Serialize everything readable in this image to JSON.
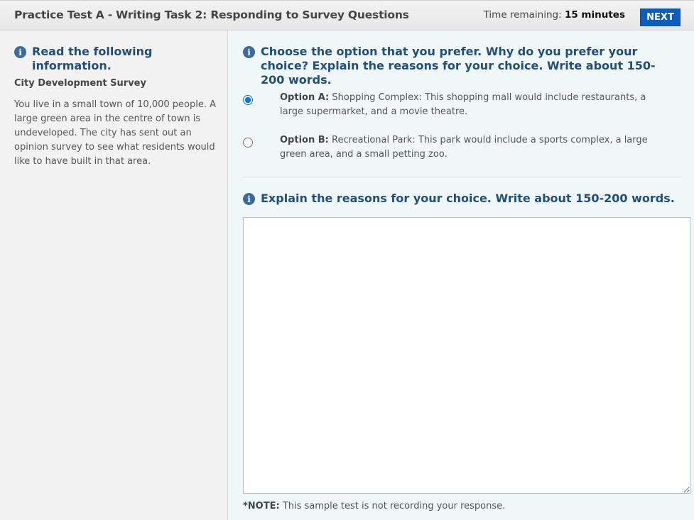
{
  "header": {
    "title": "Practice Test A - Writing Task 2: Responding to Survey Questions",
    "time_label": "Time remaining:",
    "time_value": "15 minutes",
    "next_label": "NEXT"
  },
  "left": {
    "heading": "Read the following information.",
    "survey_title": "City Development Survey",
    "survey_text": "You live in a small town of 10,000 people. A large green area in the centre of town is undeveloped. The city has sent out an opinion survey to see what residents would like to have built in that area."
  },
  "right": {
    "question_heading": "Choose the option that you prefer. Why do you prefer your choice? Explain the reasons for your choice. Write about 150-200 words.",
    "options": [
      {
        "label": "Option A:",
        "text": "Shopping Complex: This shopping mall would include restaurants, a large supermarket, and a movie theatre.",
        "selected": true
      },
      {
        "label": "Option B:",
        "text": "Recreational Park: This park would include a sports complex, a large green area, and a small petting zoo.",
        "selected": false
      }
    ],
    "explain_heading": "Explain the reasons for your choice. Write about 150-200 words.",
    "response_value": "",
    "note_label": "*NOTE:",
    "note_text": "This sample test is not recording your response."
  },
  "icons": {
    "info": "info-icon"
  },
  "colors": {
    "heading": "#224e7a",
    "next_button": "#0b5cbd",
    "left_panel_bg": "#f2f2f2",
    "right_panel_bg": "#eff7f9"
  }
}
